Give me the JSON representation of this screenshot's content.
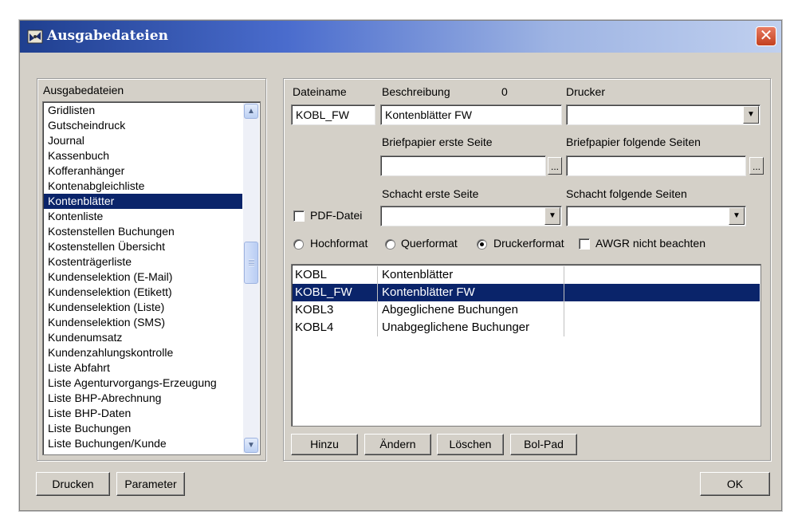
{
  "window": {
    "title": "Ausgabedateien",
    "close_glyph": "✕"
  },
  "left_panel": {
    "label": "Ausgabedateien",
    "items": [
      "Gridlisten",
      "Gutscheindruck",
      "Journal",
      "Kassenbuch",
      "Kofferanhänger",
      "Kontenabgleichliste",
      "Kontenblätter",
      "Kontenliste",
      "Kostenstellen Buchungen",
      "Kostenstellen Übersicht",
      "Kostenträgerliste",
      "Kundenselektion (E-Mail)",
      "Kundenselektion (Etikett)",
      "Kundenselektion (Liste)",
      "Kundenselektion (SMS)",
      "Kundenumsatz",
      "Kundenzahlungskontrolle",
      "Liste Abfahrt",
      "Liste Agenturvorgangs-Erzeugung",
      "Liste BHP-Abrechnung",
      "Liste BHP-Daten",
      "Liste Buchungen",
      "Liste Buchungen/Kunde"
    ],
    "selected": "Kontenblätter"
  },
  "form": {
    "dateiname_label": "Dateiname",
    "dateiname_value": "KOBL_FW",
    "beschreibung_label": "Beschreibung",
    "beschreibung_count": "0",
    "beschreibung_value": "Kontenblätter FW",
    "drucker_label": "Drucker",
    "drucker_value": "",
    "briefpapier_erste_label": "Briefpapier erste Seite",
    "briefpapier_folgende_label": "Briefpapier folgende Seiten",
    "schacht_erste_label": "Schacht erste Seite",
    "schacht_folgende_label": "Schacht folgende Seiten",
    "pdf_label": "PDF-Datei",
    "pdf_checked": false,
    "orientation": {
      "hochformat": "Hochformat",
      "querformat": "Querformat",
      "druckerformat": "Druckerformat",
      "selected": "Druckerformat"
    },
    "awgr_label": "AWGR nicht beachten",
    "awgr_checked": false
  },
  "grid": {
    "rows": [
      {
        "code": "KOBL",
        "desc": "Kontenblätter",
        "selected": false
      },
      {
        "code": "KOBL_FW",
        "desc": "Kontenblätter FW",
        "selected": true
      },
      {
        "code": "KOBL3",
        "desc": "Abgeglichene Buchungen",
        "selected": false
      },
      {
        "code": "KOBL4",
        "desc": "Unabgeglichene Buchunger",
        "selected": false
      }
    ]
  },
  "buttons": {
    "hinzu": "Hinzu",
    "aendern": "Ändern",
    "loeschen": "Löschen",
    "bolpad": "Bol-Pad",
    "drucken": "Drucken",
    "parameter": "Parameter",
    "ok": "OK",
    "dots": "...",
    "combo_arrow": "▼",
    "scroll_up": "▲",
    "scroll_down": "▼"
  },
  "colors": {
    "selection": "#0a246a",
    "dialog_face": "#d4d0c8",
    "titlebar_start": "#1f3f8f",
    "titlebar_end": "#c0d0ef"
  }
}
